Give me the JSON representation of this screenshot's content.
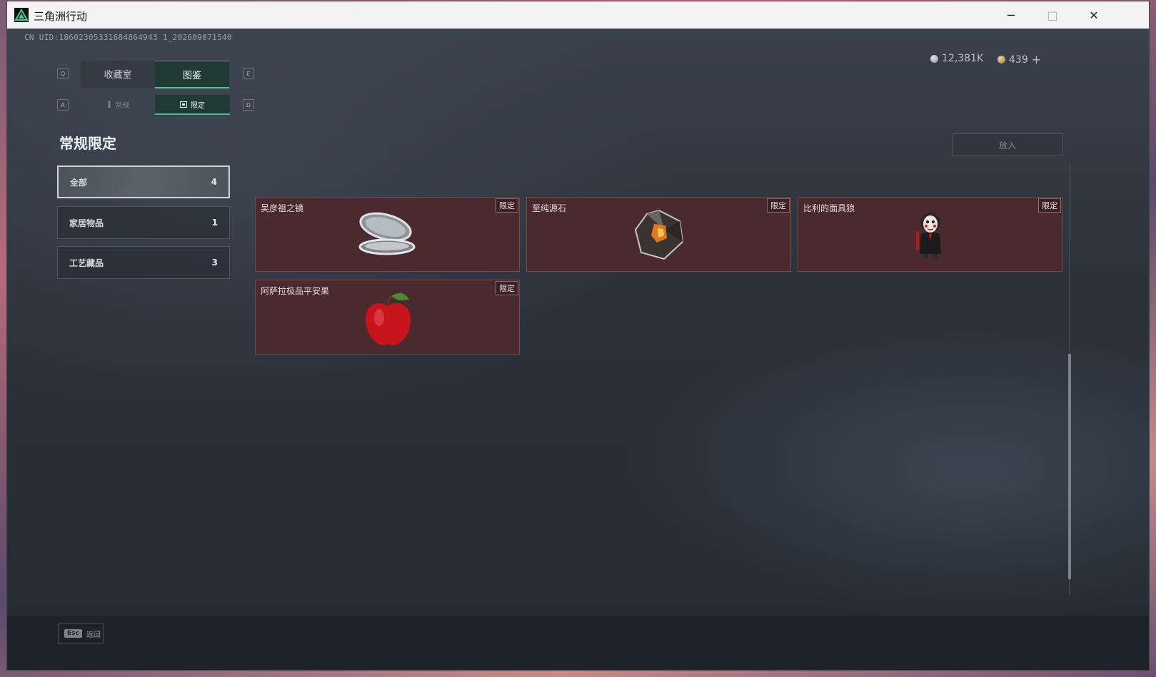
{
  "window": {
    "title": "三角洲行动",
    "minimize": "─",
    "maximize": "□",
    "close": "✕"
  },
  "uid": "CN UID:18602305331684864943 1_202609071540",
  "key_hints": {
    "prev_tab": "Q",
    "next_tab": "E",
    "prev_sub": "A",
    "next_sub": "D"
  },
  "tabs": [
    {
      "label": "收藏室",
      "active": false
    },
    {
      "label": "图鉴",
      "active": true
    }
  ],
  "subtabs": [
    {
      "label": "常规",
      "icon": "figure-icon",
      "active": false
    },
    {
      "label": "限定",
      "icon": "frame-icon",
      "active": true
    }
  ],
  "section_title": "常规限定",
  "categories": [
    {
      "label": "全部",
      "count": "4",
      "active": true
    },
    {
      "label": "家居物品",
      "count": "1",
      "active": false
    },
    {
      "label": "工艺藏品",
      "count": "3",
      "active": false
    }
  ],
  "currency": {
    "silver": {
      "value": "12,381K",
      "color": "#a9b0b6"
    },
    "gold": {
      "value": "439",
      "color": "#c9a067",
      "add": "+"
    }
  },
  "put_button": "放入",
  "items": [
    {
      "name": "吴彦祖之镜",
      "badge": "限定",
      "icon": "compact-mirror-icon"
    },
    {
      "name": "至纯源石",
      "badge": "限定",
      "icon": "source-stone-icon"
    },
    {
      "name": "比利的面具狼",
      "badge": "限定",
      "icon": "mask-doll-icon"
    },
    {
      "name": "阿萨拉极品平安果",
      "badge": "限定",
      "icon": "apple-icon"
    }
  ],
  "footer": {
    "key": "Esc",
    "label": "返回"
  },
  "colors": {
    "accent": "#5bbf8f",
    "card_bg": "#4a2a2f",
    "background": "#2a333d"
  }
}
